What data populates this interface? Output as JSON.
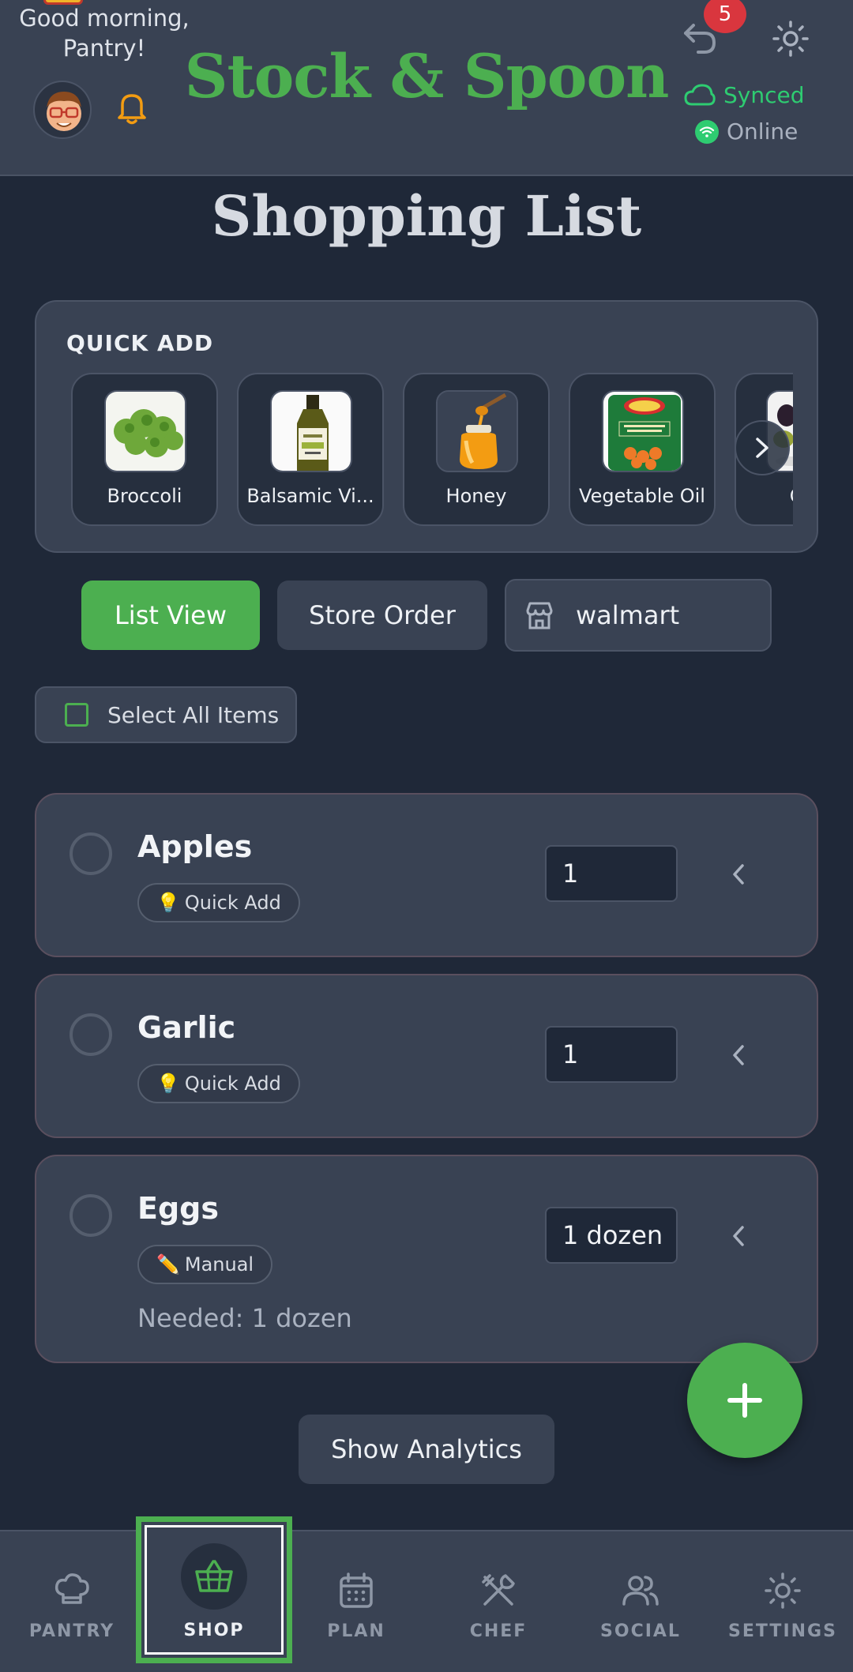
{
  "header": {
    "greeting": "Good morning,\nPantry!",
    "brand": "Stock & Spoon",
    "undo_count": "5",
    "sync_status": "Synced",
    "connection_status": "Online"
  },
  "page_title": "Shopping List",
  "quick_add": {
    "heading": "QUICK ADD",
    "items": [
      {
        "label": "Broccoli",
        "icon": "broccoli-thumbnail"
      },
      {
        "label": "Balsamic Vi...",
        "icon": "balsamic-vinegar-thumbnail"
      },
      {
        "label": "Honey",
        "icon": "honey-thumbnail"
      },
      {
        "label": "Vegetable Oil",
        "icon": "canned-carrots-thumbnail"
      },
      {
        "label": "Oliv",
        "icon": "olives-thumbnail"
      }
    ]
  },
  "view": {
    "list_view_label": "List View",
    "store_order_label": "Store Order",
    "store_name": "walmart"
  },
  "select_all_label": "Select All Items",
  "items": [
    {
      "name": "Apples",
      "tag": "Quick Add",
      "tag_icon": "lightbulb-icon",
      "quantity": "1",
      "needed": ""
    },
    {
      "name": "Garlic",
      "tag": "Quick Add",
      "tag_icon": "lightbulb-icon",
      "quantity": "1",
      "needed": ""
    },
    {
      "name": "Eggs",
      "tag": "Manual",
      "tag_icon": "pencil-icon",
      "quantity": "1 dozen",
      "needed": "Needed: 1 dozen"
    }
  ],
  "analytics_label": "Show Analytics",
  "nav": {
    "pantry": "PANTRY",
    "shop": "SHOP",
    "plan": "PLAN",
    "chef": "CHEF",
    "social": "SOCIAL",
    "settings": "SETTINGS",
    "active": "SHOP"
  },
  "colors": {
    "accent": "#4caf50",
    "background": "#1f2838",
    "surface": "#394253",
    "badge": "#d9363e",
    "synced": "#2ecc71"
  }
}
